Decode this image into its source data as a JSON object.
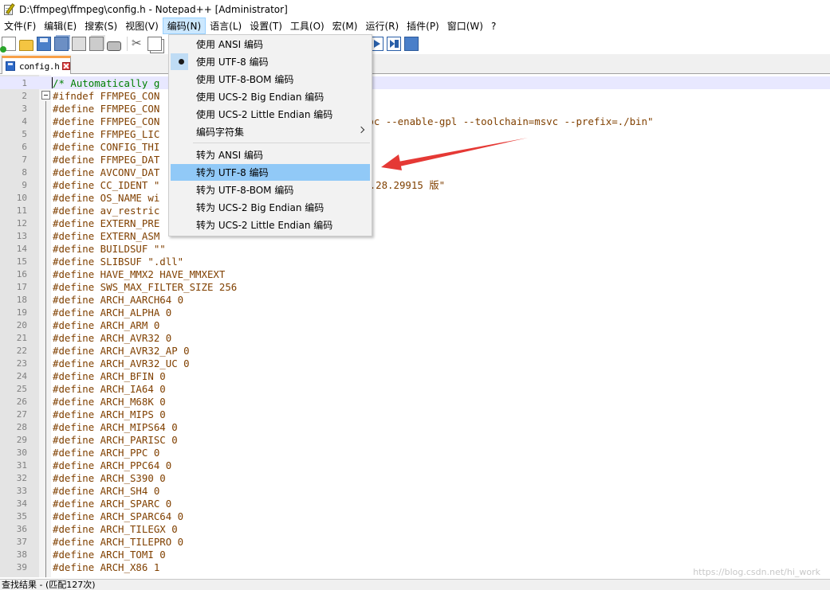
{
  "window": {
    "title": "D:\\ffmpeg\\ffmpeg\\config.h - Notepad++ [Administrator]"
  },
  "menubar": [
    {
      "label": "文件(F)",
      "name": "menu-file"
    },
    {
      "label": "编辑(E)",
      "name": "menu-edit"
    },
    {
      "label": "搜索(S)",
      "name": "menu-search"
    },
    {
      "label": "视图(V)",
      "name": "menu-view"
    },
    {
      "label": "编码(N)",
      "name": "menu-encoding",
      "active": true
    },
    {
      "label": "语言(L)",
      "name": "menu-language"
    },
    {
      "label": "设置(T)",
      "name": "menu-settings"
    },
    {
      "label": "工具(O)",
      "name": "menu-tools"
    },
    {
      "label": "宏(M)",
      "name": "menu-macro"
    },
    {
      "label": "运行(R)",
      "name": "menu-run"
    },
    {
      "label": "插件(P)",
      "name": "menu-plugins"
    },
    {
      "label": "窗口(W)",
      "name": "menu-window"
    },
    {
      "label": "?",
      "name": "menu-help"
    }
  ],
  "toolbar_icons": [
    "new-file-icon",
    "open-file-icon",
    "save-icon",
    "save-all-icon",
    "close-icon",
    "close-all-icon",
    "print-icon",
    "cut-icon",
    "copy-icon",
    "format-brush-icon",
    "sort-lines-icon",
    "show-all-characters-icon",
    "word-wrap-icon",
    "indent-guide-icon",
    "user-language-icon",
    "edit-pen-icon",
    "folder-icon",
    "monitor-eye-icon",
    "record-macro-icon",
    "stop-macro-icon",
    "play-macro-icon",
    "run-macro-multiple-icon",
    "save-macro-icon"
  ],
  "tab": {
    "label": "config.h"
  },
  "encoding_menu": {
    "items": [
      {
        "label": "使用 ANSI 编码",
        "name": "use-ansi"
      },
      {
        "label": "使用 UTF-8 编码",
        "name": "use-utf8",
        "checked": true
      },
      {
        "label": "使用 UTF-8-BOM 编码",
        "name": "use-utf8-bom"
      },
      {
        "label": "使用 UCS-2 Big Endian 编码",
        "name": "use-ucs2-be"
      },
      {
        "label": "使用 UCS-2 Little Endian 编码",
        "name": "use-ucs2-le"
      },
      {
        "label": "编码字符集",
        "name": "charset",
        "submenu": true
      },
      {
        "label": "转为 ANSI 编码",
        "name": "convert-ansi"
      },
      {
        "label": "转为 UTF-8 编码",
        "name": "convert-utf8",
        "highlighted": true
      },
      {
        "label": "转为 UTF-8-BOM 编码",
        "name": "convert-utf8-bom"
      },
      {
        "label": "转为 UCS-2 Big Endian 编码",
        "name": "convert-ucs2-be"
      },
      {
        "label": "转为 UCS-2 Little Endian 编码",
        "name": "convert-ucs2-le"
      }
    ]
  },
  "editor": {
    "current_line": 1,
    "lines": [
      {
        "n": "1",
        "text": "/* Automatically g                        odify! */",
        "comment": true
      },
      {
        "n": "2",
        "text": "#ifndef FFMPEG_CON"
      },
      {
        "n": "3",
        "text": "#define FFMPEG_CON"
      },
      {
        "n": "4",
        "text": "#define FFMPEG_CON                        able-postproc --enable-gpl --toolchain=msvc --prefix=./bin\""
      },
      {
        "n": "5",
        "text": "#define FFMPEG_LIC"
      },
      {
        "n": "6",
        "text": "#define CONFIG_THI"
      },
      {
        "n": "7",
        "text": "#define FFMPEG_DAT"
      },
      {
        "n": "8",
        "text": "#define AVCONV_DAT"
      },
      {
        "n": "9",
        "text": "#define CC_IDENT \"                        优化编译器 19.28.29915 版\""
      },
      {
        "n": "10",
        "text": "#define OS_NAME wi"
      },
      {
        "n": "11",
        "text": "#define av_restric"
      },
      {
        "n": "12",
        "text": "#define EXTERN_PRE"
      },
      {
        "n": "13",
        "text": "#define EXTERN_ASM"
      },
      {
        "n": "14",
        "text": "#define BUILDSUF \"\""
      },
      {
        "n": "15",
        "text": "#define SLIBSUF \".dll\""
      },
      {
        "n": "16",
        "text": "#define HAVE_MMX2 HAVE_MMXEXT"
      },
      {
        "n": "17",
        "text": "#define SWS_MAX_FILTER_SIZE 256"
      },
      {
        "n": "18",
        "text": "#define ARCH_AARCH64 0"
      },
      {
        "n": "19",
        "text": "#define ARCH_ALPHA 0"
      },
      {
        "n": "20",
        "text": "#define ARCH_ARM 0"
      },
      {
        "n": "21",
        "text": "#define ARCH_AVR32 0"
      },
      {
        "n": "22",
        "text": "#define ARCH_AVR32_AP 0"
      },
      {
        "n": "23",
        "text": "#define ARCH_AVR32_UC 0"
      },
      {
        "n": "24",
        "text": "#define ARCH_BFIN 0"
      },
      {
        "n": "25",
        "text": "#define ARCH_IA64 0"
      },
      {
        "n": "26",
        "text": "#define ARCH_M68K 0"
      },
      {
        "n": "27",
        "text": "#define ARCH_MIPS 0"
      },
      {
        "n": "28",
        "text": "#define ARCH_MIPS64 0"
      },
      {
        "n": "29",
        "text": "#define ARCH_PARISC 0"
      },
      {
        "n": "30",
        "text": "#define ARCH_PPC 0"
      },
      {
        "n": "31",
        "text": "#define ARCH_PPC64 0"
      },
      {
        "n": "32",
        "text": "#define ARCH_S390 0"
      },
      {
        "n": "33",
        "text": "#define ARCH_SH4 0"
      },
      {
        "n": "34",
        "text": "#define ARCH_SPARC 0"
      },
      {
        "n": "35",
        "text": "#define ARCH_SPARC64 0"
      },
      {
        "n": "36",
        "text": "#define ARCH_TILEGX 0"
      },
      {
        "n": "37",
        "text": "#define ARCH_TILEPRO 0"
      },
      {
        "n": "38",
        "text": "#define ARCH_TOMI 0"
      },
      {
        "n": "39",
        "text": "#define ARCH_X86 1"
      }
    ]
  },
  "statusbar": {
    "text": "查找结果 - (匹配127次)"
  },
  "watermark": "https://blog.csdn.net/hi_work",
  "colors": {
    "highlight": "#91c9f7",
    "arrow": "#e53935",
    "tab_accent": "#f8a048",
    "comment": "#008000",
    "code": "#804000"
  }
}
